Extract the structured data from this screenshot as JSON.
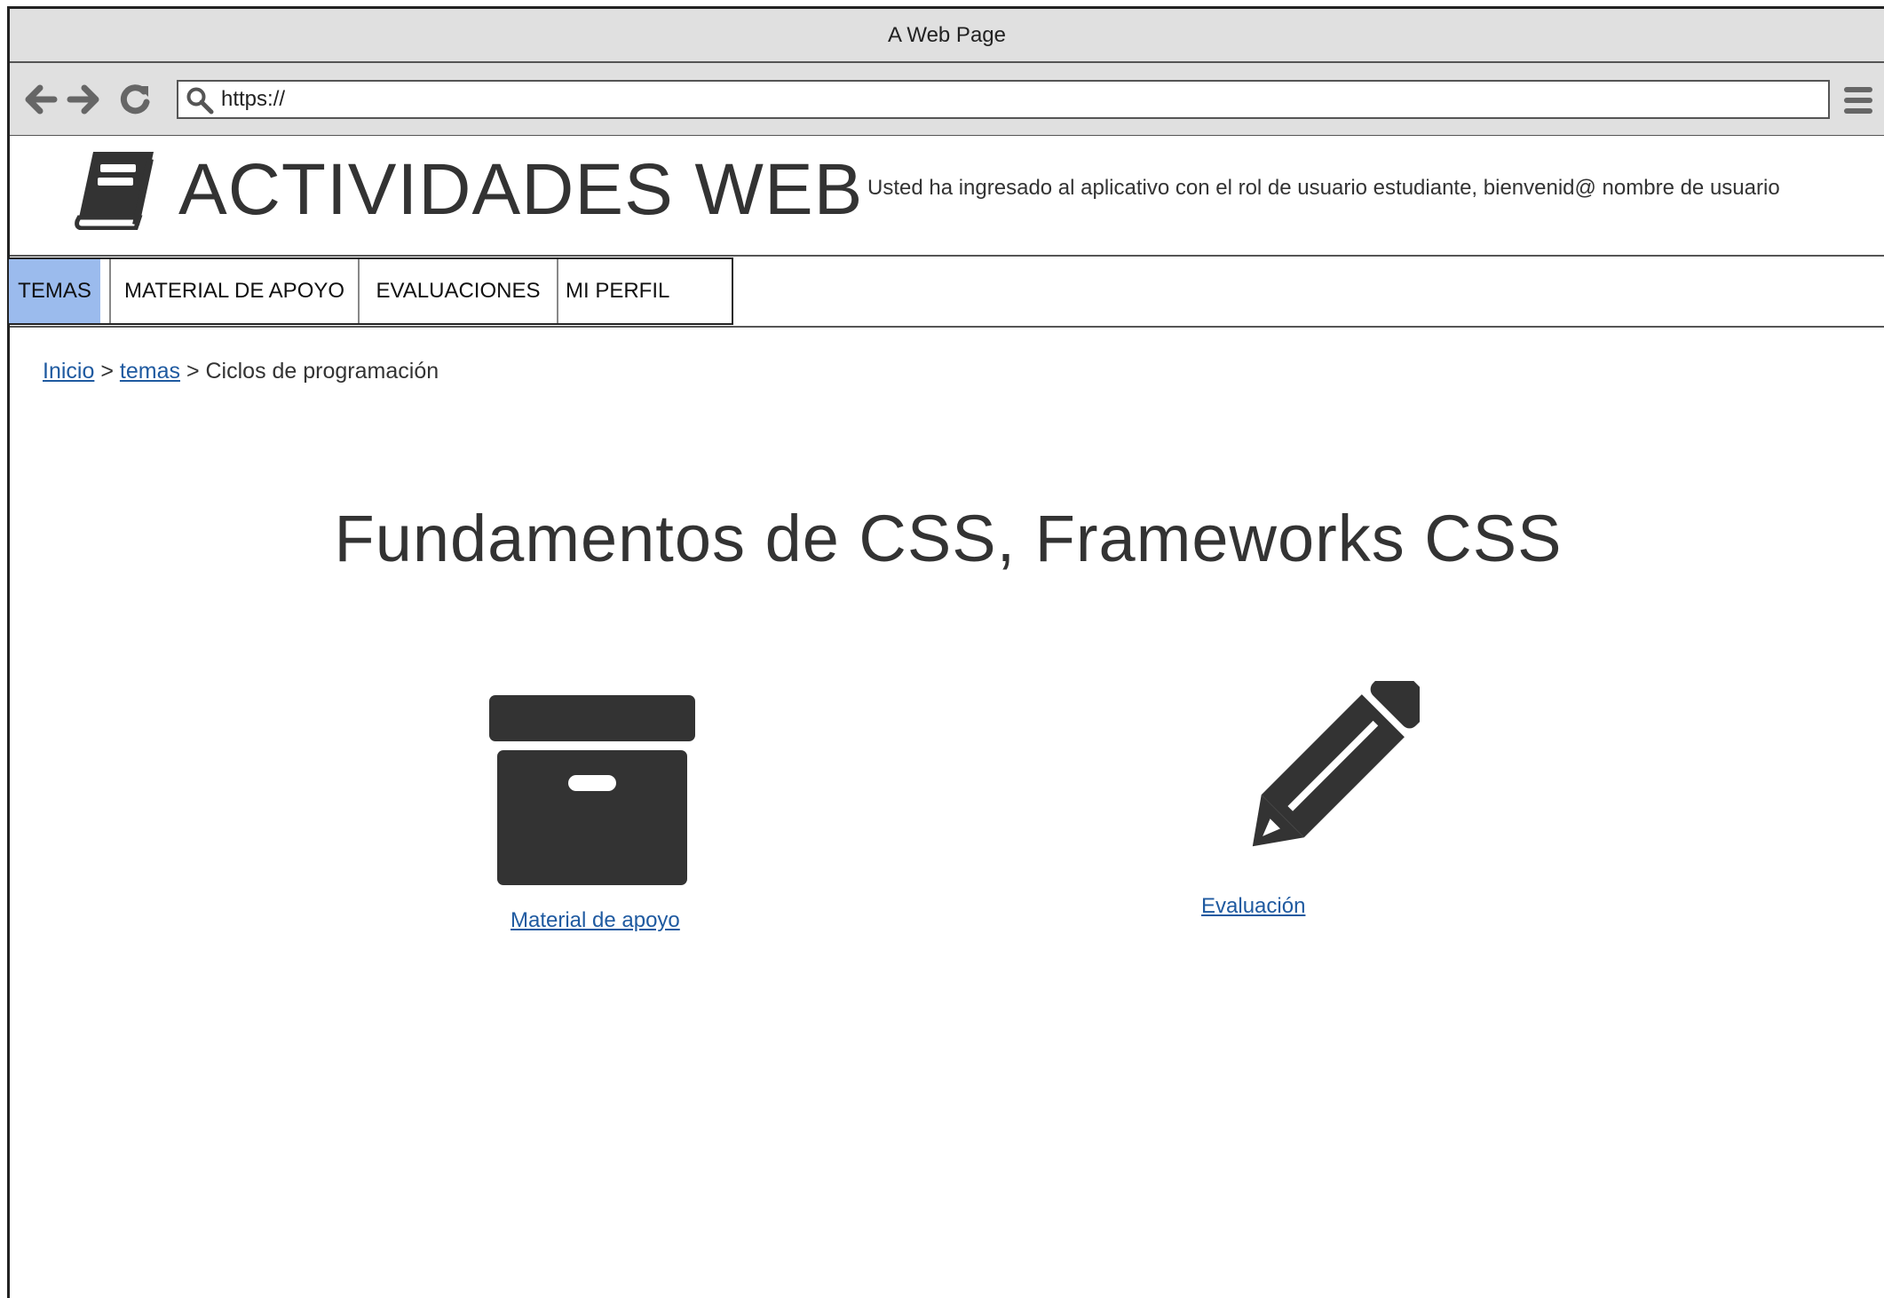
{
  "window": {
    "title": "A Web Page"
  },
  "browser": {
    "url": "https://",
    "icons": [
      "back-arrow-icon",
      "forward-arrow-icon",
      "reload-icon",
      "search-icon",
      "hamburger-menu-icon"
    ]
  },
  "header": {
    "title": "ACTIVIDADES WEB",
    "welcome": "Usted ha ingresado al aplicativo con el rol de usuario estudiante, bienvenid@ nombre de usuario",
    "logo_icon": "book-icon"
  },
  "tabs": [
    {
      "label": "TEMAS",
      "active": true
    },
    {
      "label": "MATERIAL DE APOYO",
      "active": false
    },
    {
      "label": "EVALUACIONES",
      "active": false
    },
    {
      "label": "MI PERFIL",
      "active": false
    }
  ],
  "breadcrumb": {
    "items": [
      "Inicio",
      "temas"
    ],
    "separator": ">",
    "current": "Ciclos de programación"
  },
  "main": {
    "title": "Fundamentos de CSS, Frameworks CSS",
    "cards": [
      {
        "label": "Material de apoyo",
        "icon": "archive-box-icon"
      },
      {
        "label": "Evaluación",
        "icon": "pencil-icon"
      }
    ]
  },
  "colors": {
    "active_tab": "#9bbbed",
    "link": "#1f5aa0",
    "chrome": "#e0e0e0",
    "text": "#333333"
  }
}
